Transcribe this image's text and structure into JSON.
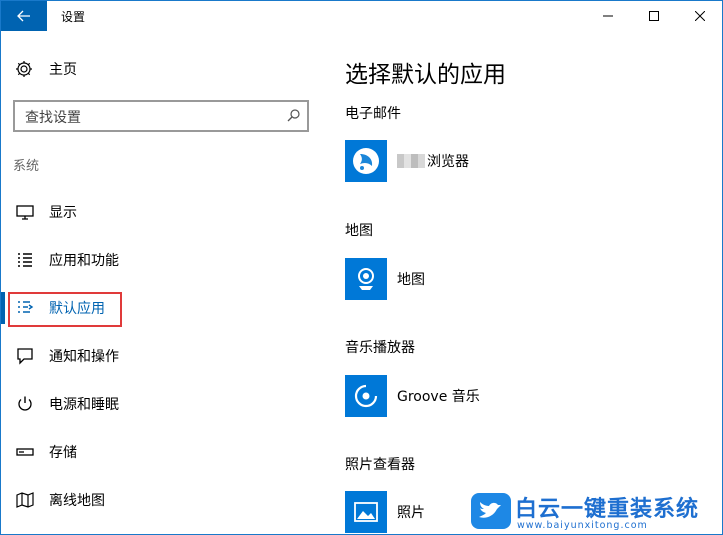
{
  "window": {
    "title": "设置",
    "accent": "#0063b1"
  },
  "nav": {
    "home_label": "主页",
    "search_placeholder": "查找设置",
    "section_label": "系统",
    "items": [
      {
        "label": "显示",
        "icon": "monitor-icon"
      },
      {
        "label": "应用和功能",
        "icon": "list-icon"
      },
      {
        "label": "默认应用",
        "icon": "default-apps-icon",
        "active": true
      },
      {
        "label": "通知和操作",
        "icon": "notification-icon"
      },
      {
        "label": "电源和睡眠",
        "icon": "power-icon"
      },
      {
        "label": "存储",
        "icon": "storage-icon"
      },
      {
        "label": "离线地图",
        "icon": "map-icon"
      }
    ]
  },
  "main": {
    "title": "选择默认的应用",
    "categories": [
      {
        "label": "电子邮件",
        "app": "浏览器",
        "icon": "browser-icon"
      },
      {
        "label": "地图",
        "app": "地图",
        "icon": "maps-app-icon"
      },
      {
        "label": "音乐播放器",
        "app": "Groove 音乐",
        "icon": "groove-music-icon"
      },
      {
        "label": "照片查看器",
        "app": "照片",
        "icon": "photos-icon"
      }
    ]
  },
  "watermark": {
    "title": "白云一键重装系统",
    "url": "www.baiyunxitong.com"
  }
}
